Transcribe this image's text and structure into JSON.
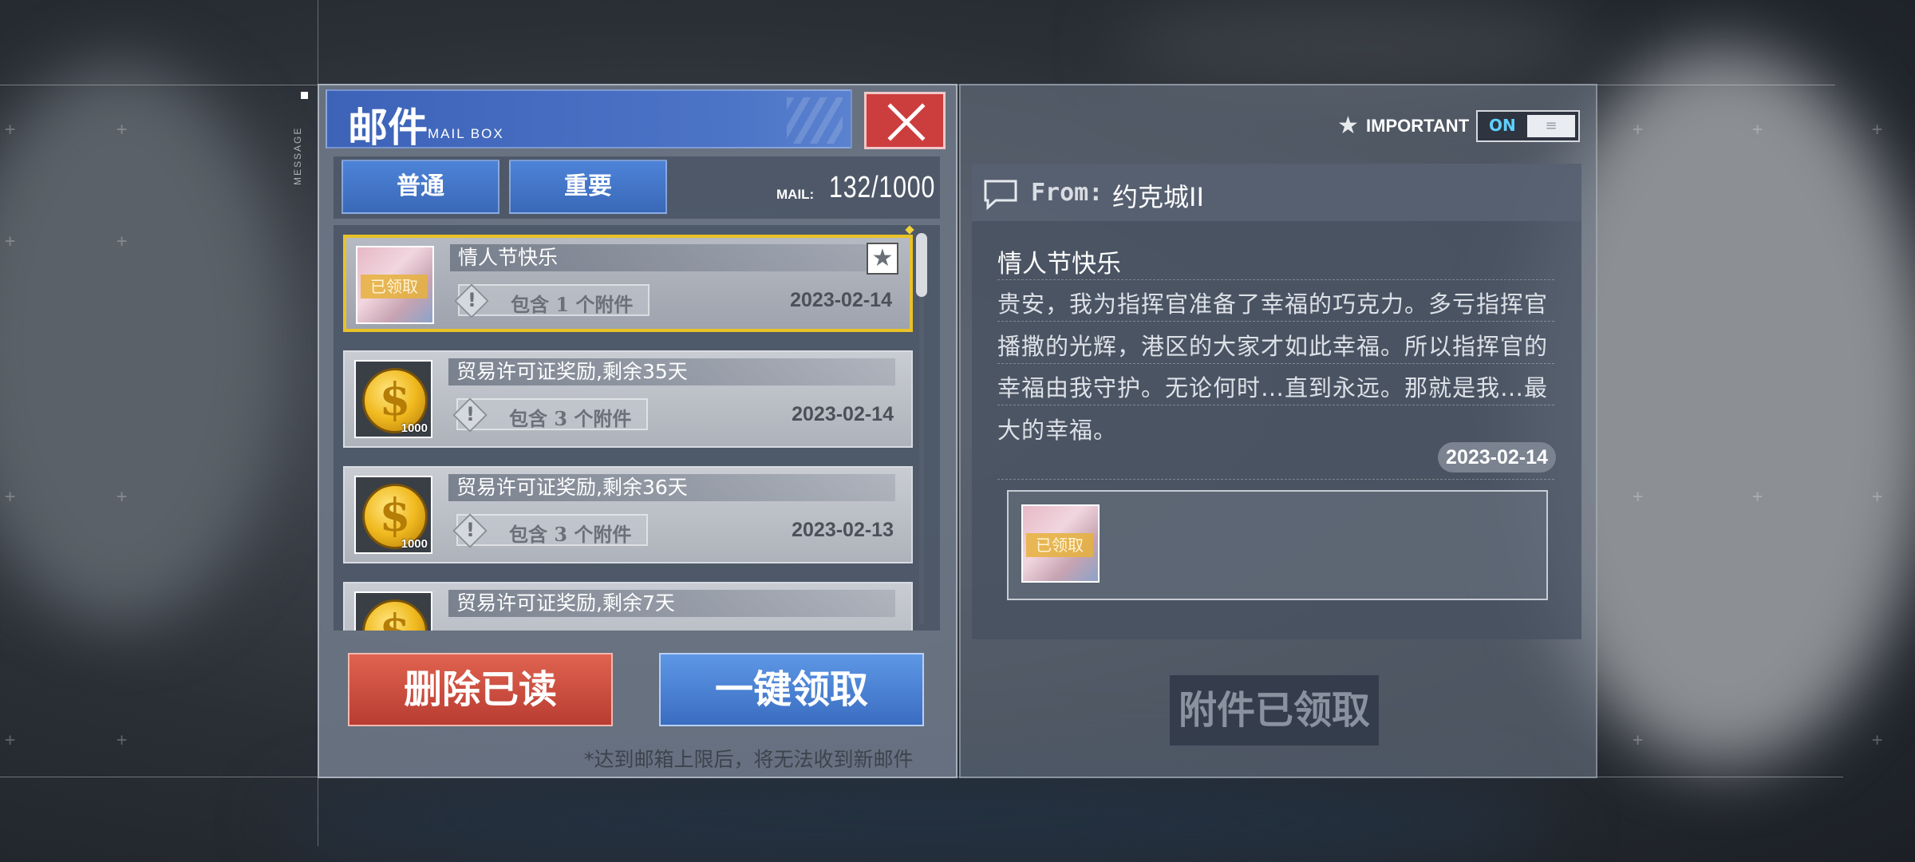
{
  "header": {
    "side_tag": "MESSAGE",
    "title_cn": "邮件",
    "title_en": "MAIL BOX"
  },
  "tabs": [
    {
      "label": "普通"
    },
    {
      "label": "重要"
    }
  ],
  "mail_counter": {
    "label": "MAIL:",
    "value": "132/1000"
  },
  "mails": [
    {
      "subject": "情人节快乐",
      "attachment": "包含 1 个附件",
      "date": "2023-02-14",
      "thumbnail": "portrait",
      "claimed_label": "已领取",
      "starred": true,
      "selected": true,
      "star_icon": "star-icon"
    },
    {
      "subject": "贸易许可证奖励,剩余35天",
      "attachment": "包含 3 个附件",
      "date": "2023-02-14",
      "thumbnail": "coin",
      "coin_qty": "1000"
    },
    {
      "subject": "贸易许可证奖励,剩余36天",
      "attachment": "包含 3 个附件",
      "date": "2023-02-13",
      "thumbnail": "coin",
      "coin_qty": "1000"
    },
    {
      "subject": "贸易许可证奖励,剩余7天",
      "thumbnail": "coin"
    }
  ],
  "actions": {
    "delete_read": "删除已读",
    "claim_all": "一键领取",
    "limit_notice": "*达到邮箱上限后，将无法收到新邮件"
  },
  "important_filter": {
    "label": "IMPORTANT",
    "toggle": "ON",
    "toggle_knob": "≡"
  },
  "detail": {
    "from_label": "From:",
    "from_name": "约克城II",
    "subject": "情人节快乐",
    "body": "贵安，我为指挥官准备了幸福的巧克力。多亏指挥官播撒的光辉，港区的大家才如此幸福。所以指挥官的幸福由我守护。无论何时…直到永远。那就是我…最大的幸福。",
    "date": "2023-02-14",
    "attachment_claimed_label": "已领取",
    "status": "附件已领取"
  },
  "colors": {
    "accent_blue": "#3d63b8",
    "delete_red": "#cc3d3d",
    "selected_gold": "#e9c227",
    "toggle_on": "#5fd0ff"
  }
}
